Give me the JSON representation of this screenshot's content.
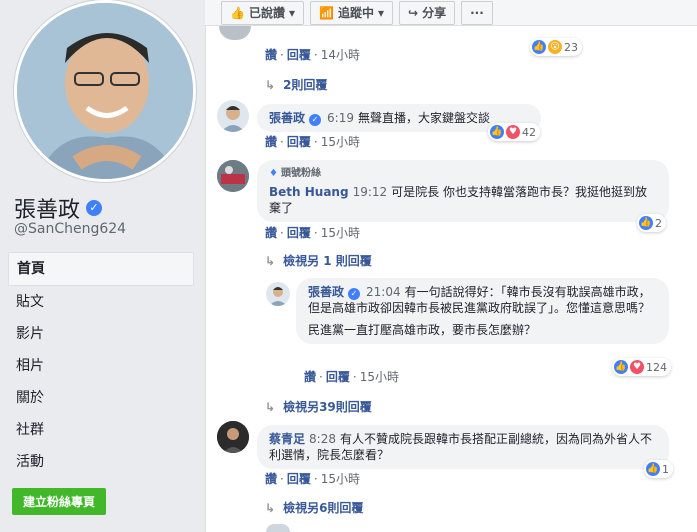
{
  "page": {
    "name": "張善政",
    "handle": "@SanCheng624",
    "nav": [
      "首頁",
      "貼文",
      "影片",
      "相片",
      "關於",
      "社群",
      "活動"
    ],
    "cta": "建立粉絲專頁"
  },
  "toolbar": {
    "liked": "已說讚",
    "following": "追蹤中",
    "share": "分享",
    "more": "···"
  },
  "comments": [
    {
      "id": "c0",
      "meta": {
        "like": "讚",
        "reply": "回覆",
        "time": "14小時"
      },
      "reactions": "23",
      "replies_link": "2則回覆"
    },
    {
      "id": "c1",
      "author": "張善政",
      "time": "6:19",
      "text": "無聲直播，大家鍵盤交談",
      "meta": {
        "like": "讚",
        "reply": "回覆",
        "time": "15小時"
      },
      "reactions": "42"
    },
    {
      "id": "c2",
      "badge": "頭號粉絲",
      "author": "Beth Huang",
      "time": "19:12",
      "text": "可是院長 你也支持韓當落跑市長？我挺他挺到放棄了",
      "meta": {
        "like": "讚",
        "reply": "回覆",
        "time": "15小時"
      },
      "reactions": "2",
      "view_more": "檢視另 1 則回覆"
    },
    {
      "id": "c3",
      "author": "張善政",
      "time": "21:04",
      "text": "有一句話說得好：「韓市長沒有耽誤高雄市政，但是高雄市政卻因韓市長被民進黨政府耽誤了」。您懂這意思嗎？",
      "text2": "民進黨一直打壓高雄市政，要市長怎麼辦？",
      "meta": {
        "like": "讚",
        "reply": "回覆",
        "time": "15小時"
      },
      "reactions": "124",
      "view_more": "檢視另39則回覆"
    },
    {
      "id": "c4",
      "author": "蔡青足",
      "time": "8:28",
      "text": "有人不贊成院長跟韓市長搭配正副總統，因為同為外省人不利選情，院長怎麼看？",
      "meta": {
        "like": "讚",
        "reply": "回覆",
        "time": "15小時"
      },
      "reactions": "1",
      "view_more": "檢視另6則回覆"
    }
  ],
  "colors": {
    "link": "#385898",
    "bubble": "#f2f3f5",
    "like": "#4080ff",
    "love": "#f25268",
    "cta": "#42b72a"
  }
}
